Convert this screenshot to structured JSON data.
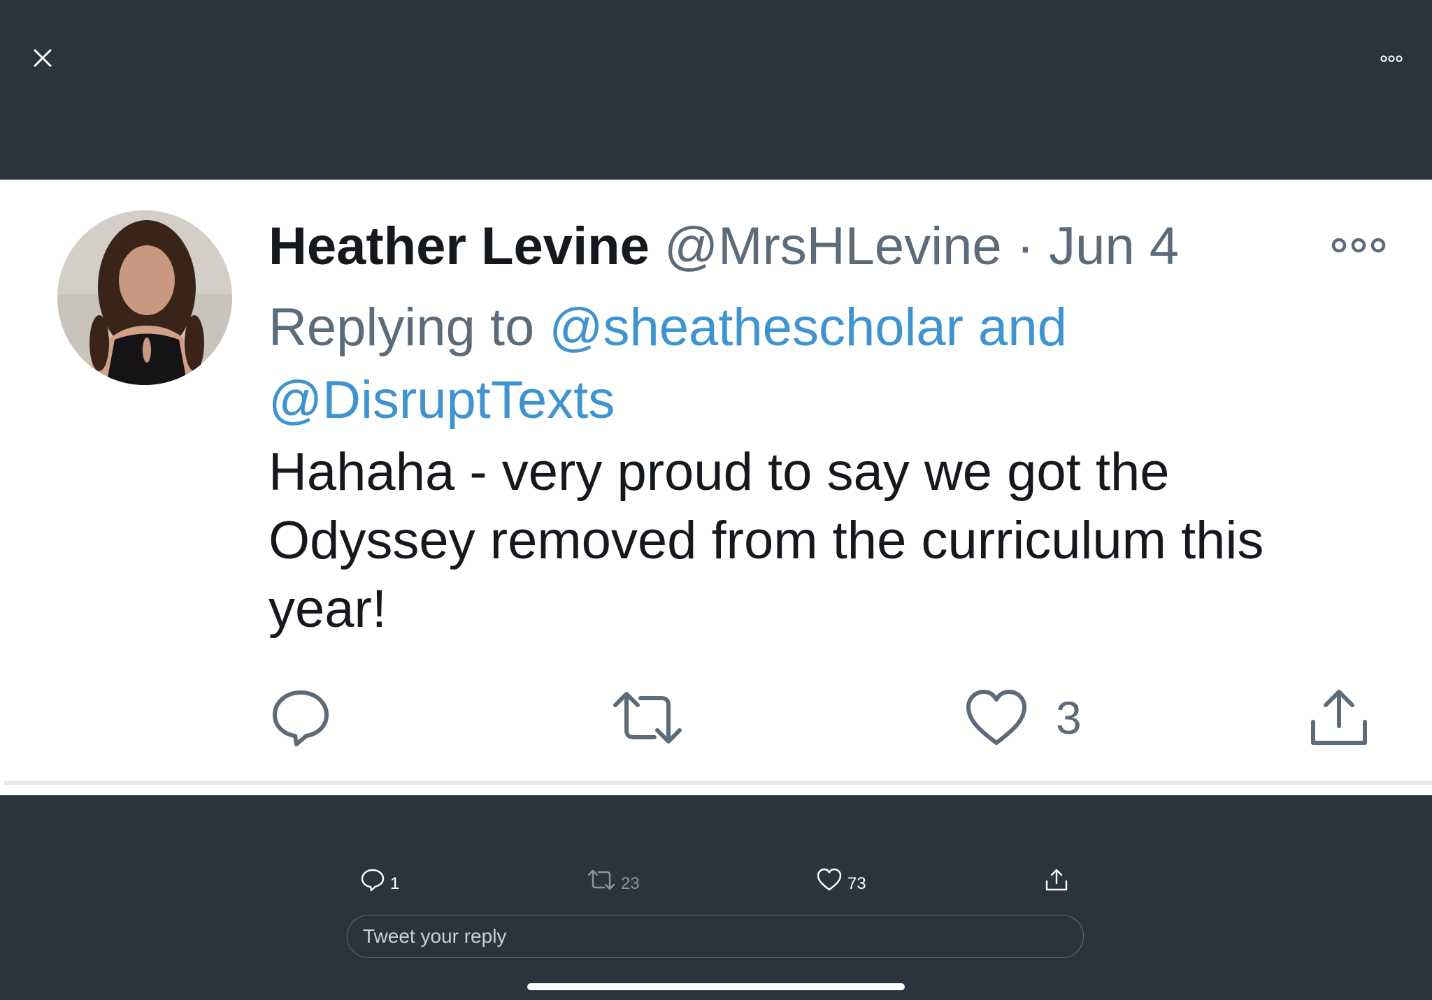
{
  "top_bar": {
    "close_icon": "close-icon",
    "more_icon": "more-dots-icon"
  },
  "tweet": {
    "author_name": "Heather Levine",
    "handle": "@MrsHLevine",
    "separator": " · ",
    "date": "Jun 4",
    "replying_prefix": "Replying to ",
    "reply_mentions_line1": "@sheathescholar and",
    "reply_mentions_line2": "@DisruptTexts",
    "text_line1": "Hahaha - very proud to say we got the",
    "text_line2": "Odyssey removed from the curriculum this",
    "text_line3": "year!",
    "like_count": "3"
  },
  "stats": {
    "replies": "1",
    "retweets": "23",
    "likes": "73"
  },
  "reply_input": {
    "placeholder": "Tweet your reply"
  },
  "colors": {
    "background": "#29343f",
    "card": "#ffffff",
    "link": "#3f93cf",
    "muted": "#5b6b7a",
    "text": "#15191e"
  }
}
